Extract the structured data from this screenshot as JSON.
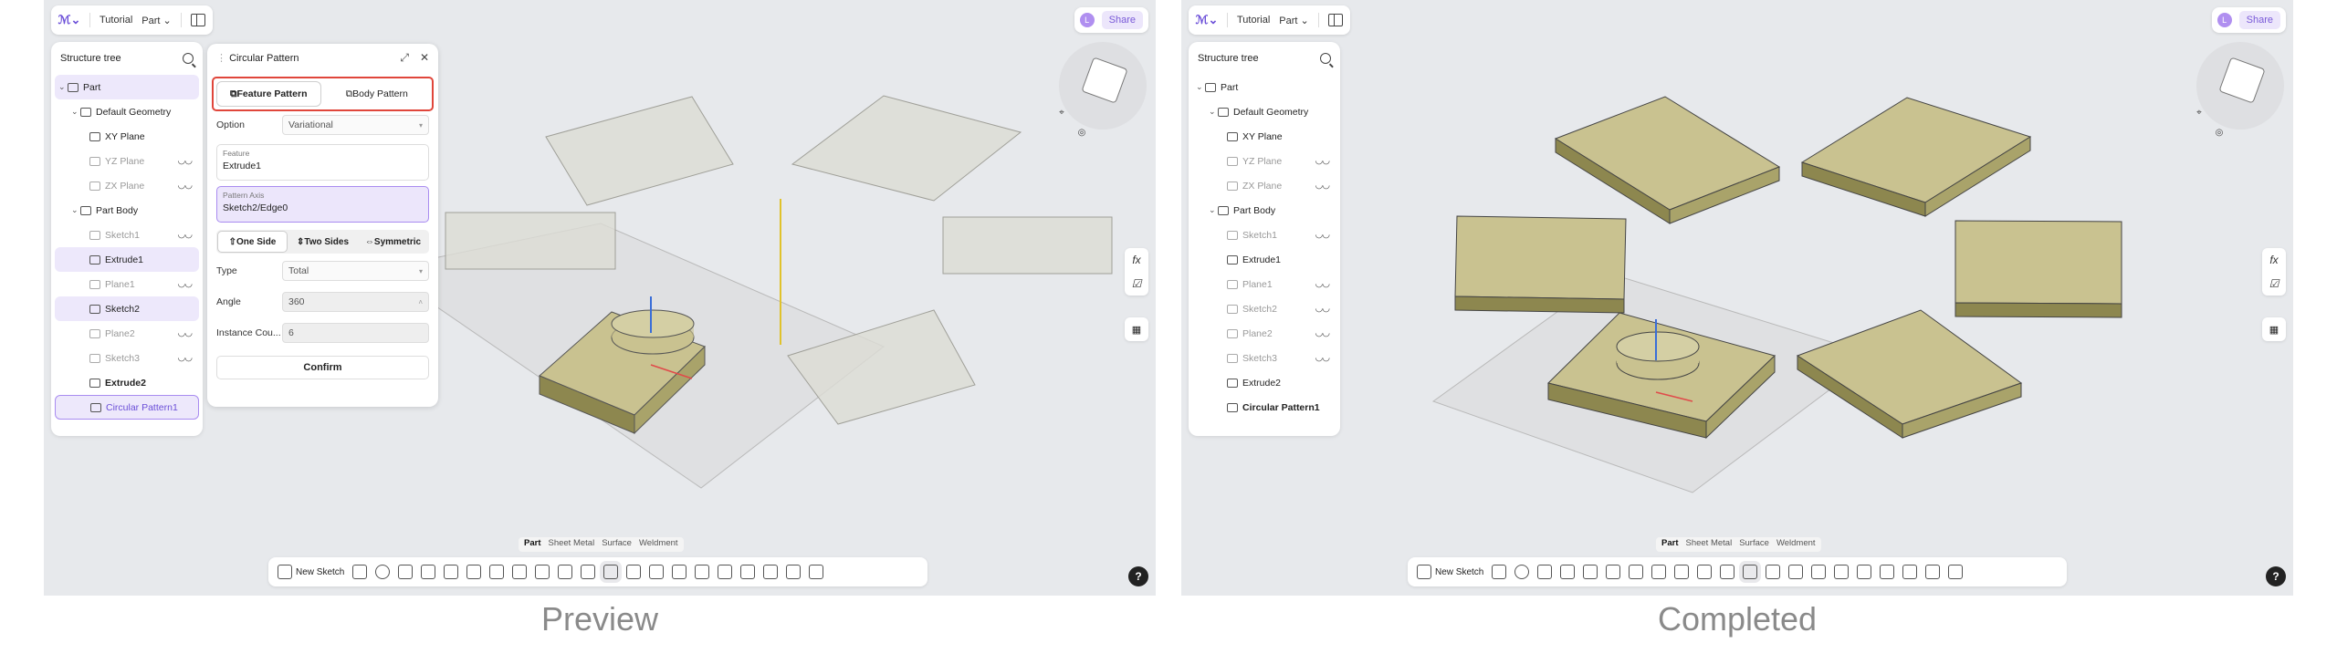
{
  "panels": [
    {
      "caption": "Preview",
      "topbar": {
        "breadcrumb1": "Tutorial",
        "breadcrumb2": "Part",
        "share": "Share",
        "avatar": "L"
      },
      "tree": {
        "title": "Structure tree",
        "items": [
          "Part",
          "Default Geometry",
          "XY Plane",
          "YZ Plane",
          "ZX Plane",
          "Part Body",
          "Sketch1",
          "Extrude1",
          "Plane1",
          "Sketch2",
          "Plane2",
          "Sketch3",
          "Extrude2",
          "Circular Pattern1"
        ]
      },
      "dialog": {
        "title": "Circular Pattern",
        "feature_pattern": "Feature Pattern",
        "body_pattern": "Body Pattern",
        "option_label": "Option",
        "option_value": "Variational",
        "feature_label": "Feature",
        "feature_value": "Extrude1",
        "axis_label": "Pattern Axis",
        "axis_value": "Sketch2/Edge0",
        "one_side": "One Side",
        "two_sides": "Two Sides",
        "symmetric": "Symmetric",
        "type_label": "Type",
        "type_value": "Total",
        "angle_label": "Angle",
        "angle_value": "360",
        "count_label": "Instance Cou...",
        "count_value": "6",
        "confirm": "Confirm"
      }
    },
    {
      "caption": "Completed",
      "topbar": {
        "breadcrumb1": "Tutorial",
        "breadcrumb2": "Part",
        "share": "Share",
        "avatar": "L"
      },
      "tree": {
        "title": "Structure tree",
        "items": [
          "Part",
          "Default Geometry",
          "XY Plane",
          "YZ Plane",
          "ZX Plane",
          "Part Body",
          "Sketch1",
          "Extrude1",
          "Plane1",
          "Sketch2",
          "Plane2",
          "Sketch3",
          "Extrude2",
          "Circular Pattern1"
        ]
      }
    }
  ],
  "bottom": {
    "tabs": [
      "Part",
      "Sheet Metal",
      "Surface",
      "Weldment"
    ],
    "new_sketch": "New Sketch"
  },
  "colors": {
    "accent": "#7a5ad8",
    "highlight_red": "#e0463b",
    "solid_face": "#c9c290",
    "ghost_face": "#dcdcd4"
  }
}
